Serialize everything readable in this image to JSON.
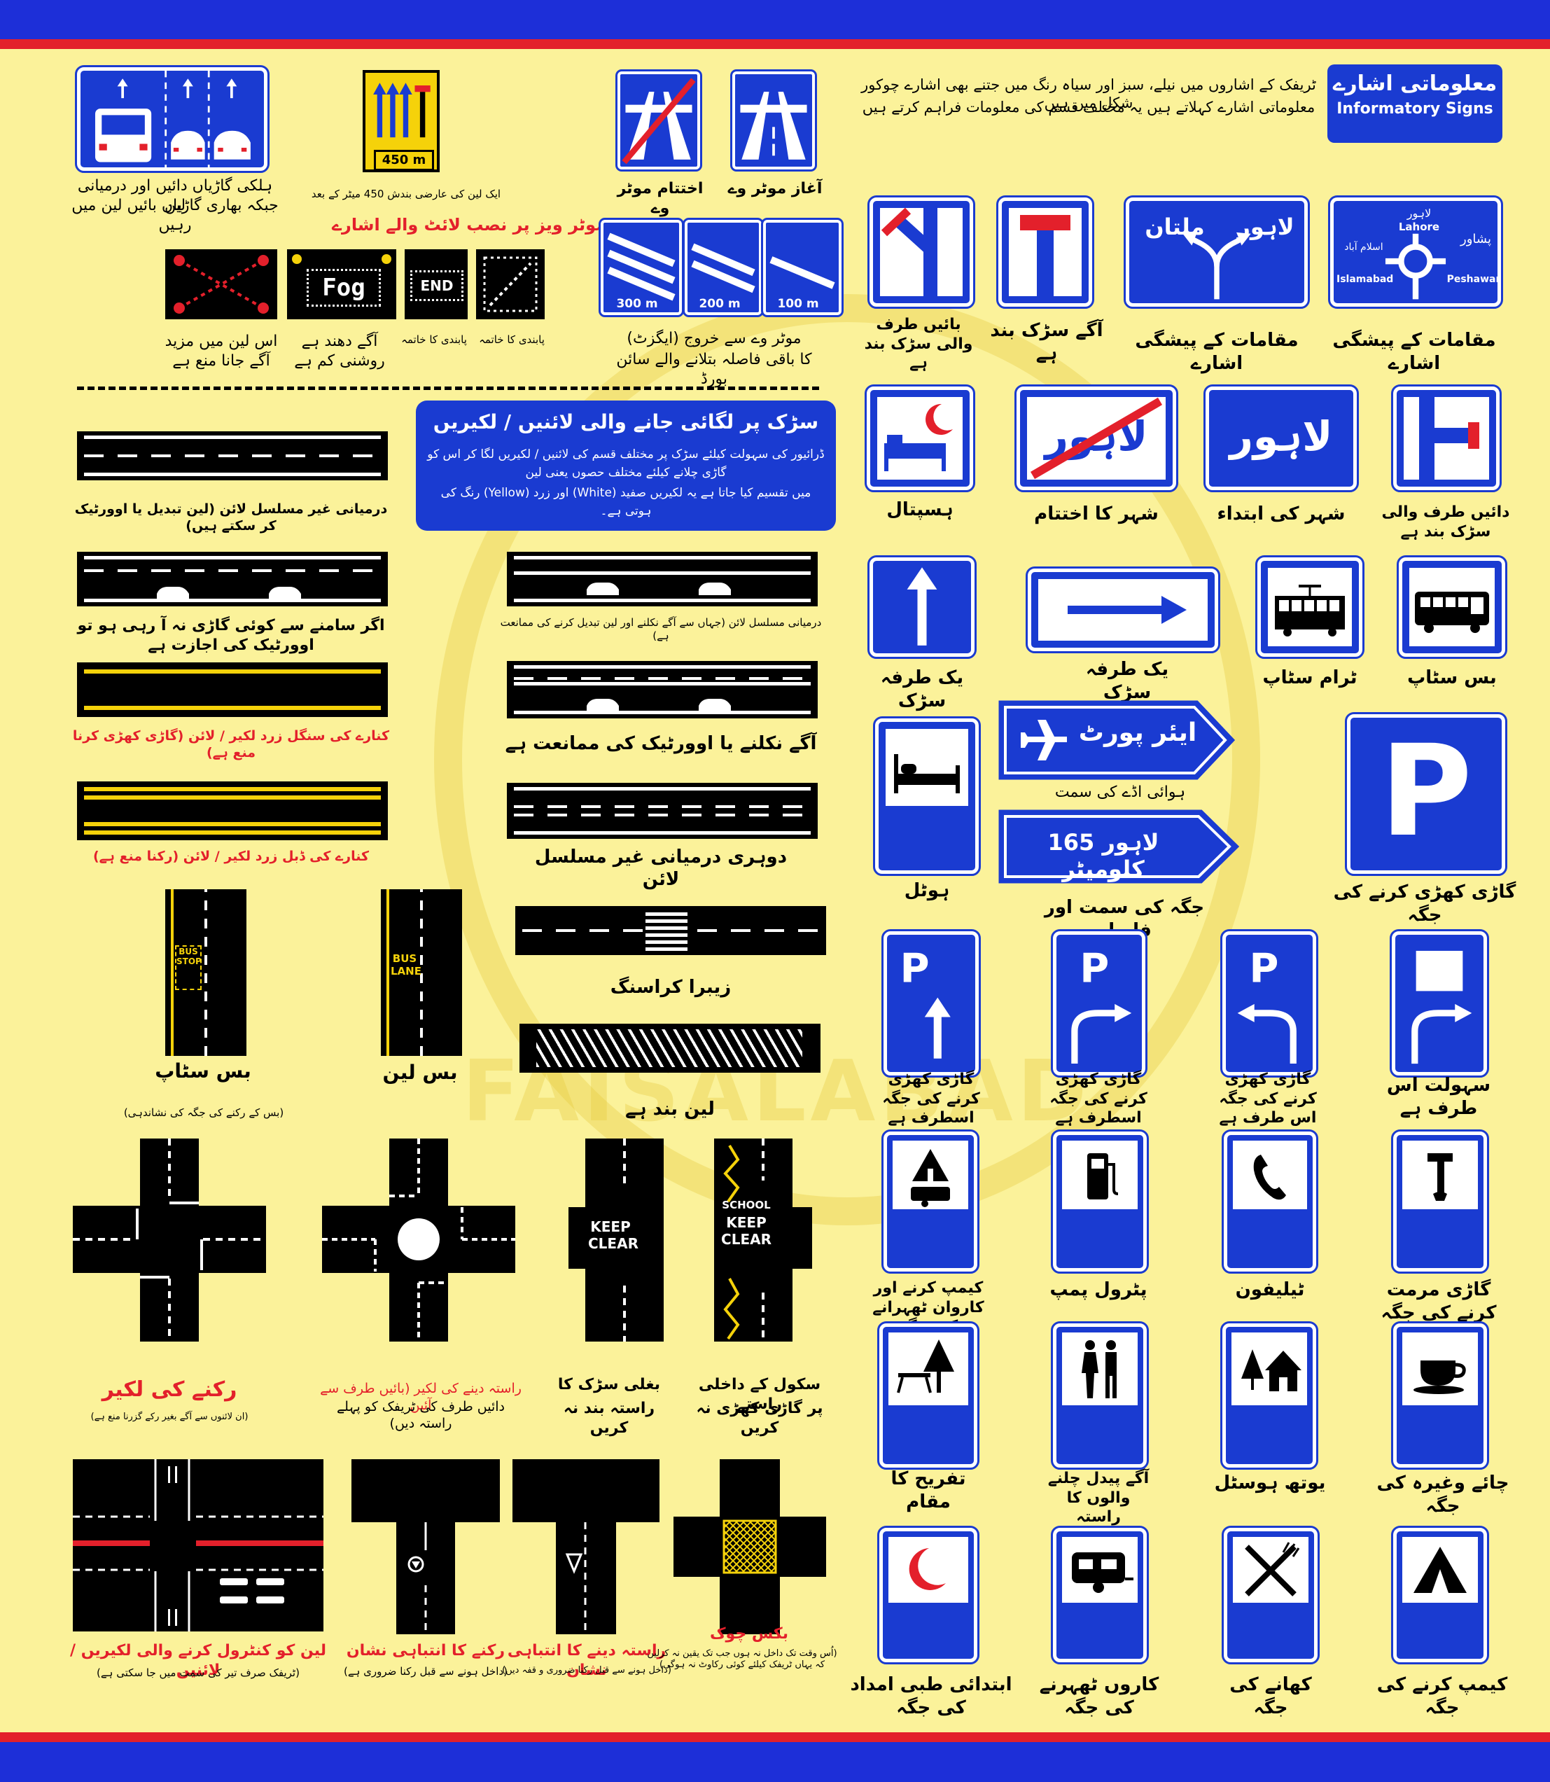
{
  "colors": {
    "background": "#fbf29a",
    "band_blue": "#1d2fd8",
    "band_red": "#e3202b",
    "sign_blue": "#1a3bd1",
    "road": "#000000",
    "yellow_line": "#f5d20a"
  },
  "watermark": {
    "text": "FAISALABAD"
  },
  "header": {
    "title_ur": "معلوماتی اشارے",
    "title_en": "Informatory Signs",
    "intro_line1": "ٹریفک کے اشاروں میں نیلے، سبز اور سیاہ رنگ میں جتنے بھی اشارے چوکور شکل میں ہیں",
    "intro_line2": "معلوماتی اشارے کہلاتے ہیں یہ مختلف قسم کی معلومات فراہم کرتے ہیں"
  },
  "top_left": {
    "lane_sign_caption_1": "ہلکی گاڑیاں دائیں اور درمیانی لین",
    "lane_sign_caption_2": "جبکہ بھاری گاڑیاں بائیں لین میں رہیں",
    "distance_sign_value": "450 m",
    "distance_sign_caption": "ایک لین کی عارضی بندش 450 میٹر کے بعد",
    "motorway_light_title": "موٹر ویز پر نصب لائٹ والے اشارے",
    "fog_text": "Fog",
    "end_text": "END",
    "light_caps": {
      "x_sign": "اس لین میں مزید آگے جانا منع ہے",
      "fog": "آگے دھند ہے روشنی کم ہے",
      "end": "پابندی کا خاتمہ",
      "diag": "پابندی کا خاتمہ"
    }
  },
  "motorway": {
    "start_caption": "آغاز موٹر وے",
    "end_caption": "اختتام موٹر وے",
    "exit_values": [
      "300 m",
      "200 m",
      "100 m"
    ],
    "exit_caption_1": "موٹر وے سے خروج (ایگزٹ)",
    "exit_caption_2": "کا باقی فاصلہ بتلانے والے سائن بورڈ"
  },
  "info_signs": {
    "row1": {
      "left_closed": "بائیں طرف والی سڑک بند ہے",
      "ahead_closed": "آگے سڑک بند ہے",
      "advance_direction": "مقامات کے پیشگی اشارے",
      "advance_roundabout": "مقامات کے پیشگی اشارے",
      "lahore_label": "لاہور",
      "multan_label": "ملتان",
      "rb_lahore_ur": "لاہور",
      "rb_lahore_en": "Lahore",
      "rb_peshawar_ur": "پشاور",
      "rb_islamabad_ur": "اسلام آباد",
      "rb_islamabad_en": "Islamabad",
      "rb_peshawar_en": "Peshawar"
    },
    "row2": {
      "hospital": "ہسپتال",
      "city_end": "شہر کا اختتام",
      "city_start": "شہر کی ابتداء",
      "right_closed": "دائیں طرف والی سڑک بند ہے",
      "city_text": "لاہور"
    },
    "row3": {
      "one_way_up": "یک طرفہ سڑک",
      "one_way_right": "یک طرفہ سڑک",
      "tram_stop": "ٹرام سٹاپ",
      "bus_stop": "بس سٹاپ"
    },
    "row4": {
      "hotel": "ہوٹل",
      "airport_text": "ایئر پورٹ",
      "airport_caption": "ہوائی اڈے کی سمت",
      "lahore_dist_text": "لاہور 165 کلومیٹر",
      "lahore_dist_caption": "جگہ کی سمت اور فاصلہ",
      "parking_letter": "P",
      "parking": "گاڑی کھڑی کرنے کی جگہ"
    },
    "row5": {
      "p_ahead": "گاڑی کھڑی کرنے کی جگہ اسطرف ہے",
      "p_right": "گاڑی کھڑی کرنے کی جگہ اسطرف ہے",
      "p_left": "گاڑی کھڑی کرنے کی جگہ اس طرف ہے",
      "facility_here": "سہولت اس طرف ہے"
    },
    "row6": {
      "camp_caravan": "کیمپ کرنے اور کاروان ٹھہرانے کی جگہ",
      "petrol_pump": "پٹرول پمپ",
      "telephone": "ٹیلیفون",
      "repair": "گاڑی مرمت کرنے کی جگہ"
    },
    "row7": {
      "picnic": "تفریح کا مقام",
      "pedestrians": "آگے پیدل چلنے والوں کا راستہ",
      "youth_hostel": "یوتھ ہوسٹل",
      "tea": "چائے وغیرہ کی جگہ"
    },
    "row8": {
      "first_aid": "ابتدائی طبی امداد کی جگہ",
      "caravan": "کاروں ٹھہرنے کی جگہ",
      "food": "کھانے کی جگہ",
      "camping": "کیمپ کرنے کی جگہ"
    }
  },
  "road_lines": {
    "title": "سڑک پر لگائی جانے والی لائنیں / لکیریں",
    "desc_1": "ڈرائیور کی سہولت کیلئے سڑک پر مختلف قسم کی لائنیں / لکیریں لگا کر اس کو گاڑی چلانے کیلئے مختلف حصوں یعنی لین",
    "desc_2": "میں تقسیم کیا جاتا ہے یہ لکیریں صفید (White) اور زرد (Yellow) رنگ کی ہوتی ہے۔",
    "broken_center": "درمیانی غیر مسلسل لائن (لین تبدیل یا اوورٹیک کر سکتے ہیں)",
    "overtake_allowed": "اگر سامنے سے کوئی گاڑی نہ آ رہی ہو تو اوورٹیک کی اجازت ہے",
    "continuous_center": "درمیانی مسلسل لائن (جہاں سے آگے نکلنے اور لین تبدیل کرنے کی ممانعت ہے)",
    "single_yellow": "کنارے کی سنگل زرد لکیر / لائن (گاڑی کھڑی کرنا منع ہے)",
    "no_overtake": "آگے نکلنے یا اوورٹیک کی ممانعت ہے",
    "double_broken_1": "دوہری درمیانی غیر مسلسل",
    "double_broken_2": "لائن",
    "double_yellow": "کنارے کی ڈبل زرد لکیر / لائن (رکنا منع ہے)",
    "zebra": "زیبرا کراسنگ",
    "lane_closed": "لین بند ہے",
    "bus_stop_title": "بس سٹاپ",
    "bus_stop_sub": "(بس کے رکنے کی جگہ کی نشاندہی)",
    "bus_lane": "بس لین",
    "bus_text": "BUS",
    "stop_text": "STOP",
    "lane_text": "LANE",
    "keep_text": "KEEP",
    "clear_text": "CLEAR",
    "school_text": "SCHOOL",
    "stop_line": "رکنے کی لکیر",
    "stop_line_sub": "(ان لائنوں سے آگے بغیر رکے گزرنا منع ہے)",
    "give_way_line": "راستہ دینے کی لکیر (بائیں طرف سے آئیں",
    "give_way_line_2": "دائیں طرف کی ٹریفک کو پہلے راستہ دیں)",
    "side_road_1": "بغلی سڑک کا",
    "side_road_2": "راستہ بند نہ کریں",
    "school_1": "سکول کے داخلی راستے",
    "school_2": "پر گاڑی کھڑی نہ کریں",
    "lane_control": "لین کو کنٹرول کرنے والی لکیریں / لائنیں",
    "lane_control_sub": "(ٹریفک صرف تیر کی سمت میں جا سکتی ہے)",
    "stop_mark": "رکنے کا انتباہی نشان",
    "stop_mark_sub": "(داخل ہونے سے قبل رکنا ضروری ہے)",
    "give_way_mark": "راستہ دینے کا انتباہی نشان",
    "give_way_mark_sub": "(داخل ہونے سے قبل رکنا ضروری و قفہ دیں)",
    "box_junction": "بکس چوک",
    "box_junction_sub": "(اُس وقت تک داخل نہ ہوں جب تک یقین نہ کرلیں کہ یہاں ٹریفک کیلئے کوئی رکاوٹ نہ ہوگی)"
  }
}
